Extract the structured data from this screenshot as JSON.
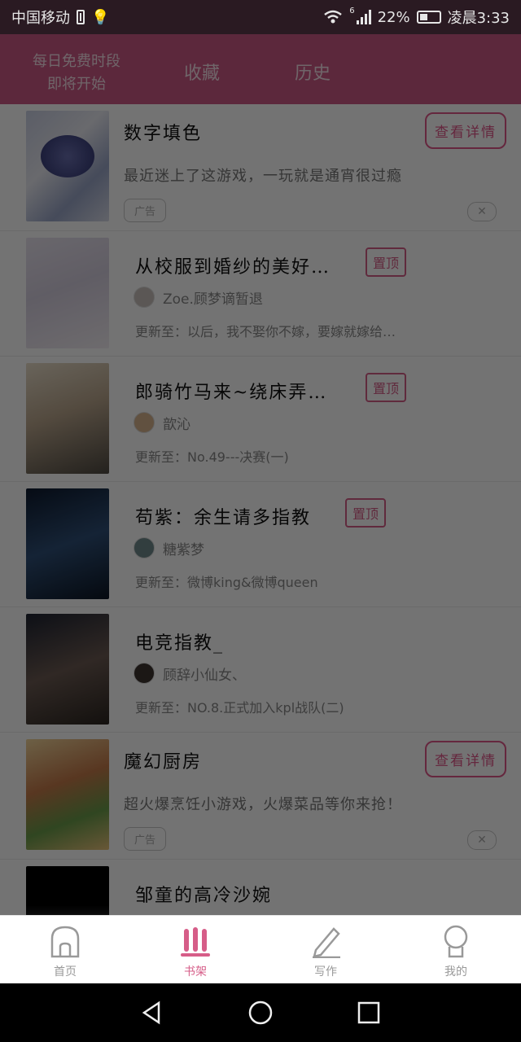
{
  "status_bar": {
    "carrier": "中国移动",
    "network": "6",
    "battery_percent": "22%",
    "time": "凌晨3:33"
  },
  "header": {
    "daily_free_line1": "每日免费时段",
    "daily_free_line2": "即将开始",
    "tab_favorites": "收藏",
    "tab_history": "历史"
  },
  "list": {
    "items": [
      {
        "type": "ad",
        "title": "数字填色",
        "desc": "最近迷上了这游戏，一玩就是通宵很过瘾",
        "button": "查看详情",
        "ad_label": "广告",
        "close": "✕"
      },
      {
        "type": "book",
        "title": "从校服到婚纱的美好…",
        "pin": "置顶",
        "author": "Zoe.顾梦谪暂退",
        "update": "更新至：以后，我不娶你不嫁，要嫁就嫁给…"
      },
      {
        "type": "book",
        "title": "郎骑竹马来~绕床弄…",
        "pin": "置顶",
        "author": "歆沁",
        "update": "更新至：No.49---决赛(一)"
      },
      {
        "type": "book",
        "title": "苟紫：余生请多指教",
        "pin": "置顶",
        "author": "糖紫梦",
        "update": "更新至：微博king&微博queen"
      },
      {
        "type": "book",
        "title": "电竞指教_",
        "author": "顾辞小仙女、",
        "update": "更新至：NO.8.正式加入kpl战队(二)"
      },
      {
        "type": "ad",
        "title": "魔幻厨房",
        "desc": "超火爆烹饪小游戏，火爆菜品等你来抢！",
        "button": "查看详情",
        "ad_label": "广告",
        "close": "✕"
      },
      {
        "type": "book",
        "title": "邹童的高冷沙婉"
      }
    ]
  },
  "tabbar": {
    "home": "首页",
    "shelf": "书架",
    "write": "写作",
    "mine": "我的"
  },
  "colors": {
    "brand": "#d65d88",
    "header_bg": "#cd5a86",
    "status_bg": "#2a1a22"
  }
}
